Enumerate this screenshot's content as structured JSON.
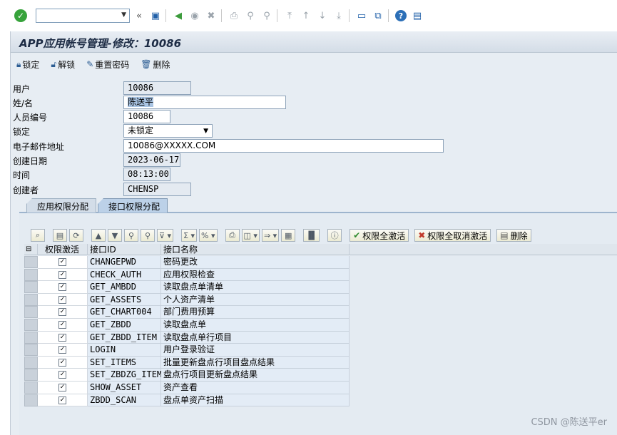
{
  "systoolbar": {
    "command_value": "",
    "icons": [
      "enter-icon",
      "save-icon",
      "back-icon",
      "exit-icon",
      "cancel-icon",
      "print-icon",
      "find-icon",
      "find-next-icon",
      "first-page-icon",
      "prev-page-icon",
      "next-page-icon",
      "last-page-icon",
      "new-session-icon",
      "shortcut-icon",
      "help-icon",
      "layout-icon"
    ]
  },
  "header": {
    "title": "APP应用帐号管理-修改：10086"
  },
  "apptoolbar": {
    "lock": "锁定",
    "unlock": "解锁",
    "reset_password": "重置密码",
    "delete": "删除"
  },
  "form": {
    "user_label": "用户",
    "user_value": "10086",
    "name_label": "姓/名",
    "name_value": "陈送平",
    "staff_label": "人员编号",
    "staff_value": "10086",
    "lock_label": "锁定",
    "lock_value": "未锁定",
    "email_label": "电子邮件地址",
    "email_value": "10086@XXXXX.COM",
    "date_label": "创建日期",
    "date_value": "2023-06-17",
    "time_label": "时间",
    "time_value": "08:13:00",
    "creator_label": "创建者",
    "creator_value": "CHENSP"
  },
  "tabs": [
    {
      "label": "应用权限分配"
    },
    {
      "label": "接口权限分配"
    }
  ],
  "alv": {
    "activate_all": "权限全激活",
    "deactivate_all": "权限全取消激活",
    "delete": "删除"
  },
  "grid": {
    "columns": {
      "active": "权限激活",
      "id": "接口ID",
      "name": "接口名称"
    },
    "rows": [
      {
        "id": "CHANGEPWD",
        "name": "密码更改",
        "checked": true
      },
      {
        "id": "CHECK_AUTH",
        "name": "应用权限检查",
        "checked": true
      },
      {
        "id": "GET_AMBDD",
        "name": "读取盘点单清单",
        "checked": true
      },
      {
        "id": "GET_ASSETS",
        "name": "个人资产清单",
        "checked": true
      },
      {
        "id": "GET_CHART004",
        "name": "部门费用预算",
        "checked": true
      },
      {
        "id": "GET_ZBDD",
        "name": "读取盘点单",
        "checked": true
      },
      {
        "id": "GET_ZBDD_ITEM",
        "name": "读取盘点单行项目",
        "checked": true
      },
      {
        "id": "LOGIN",
        "name": "用户登录验证",
        "checked": true
      },
      {
        "id": "SET_ITEMS",
        "name": "批量更新盘点行项目盘点结果",
        "checked": true
      },
      {
        "id": "SET_ZBDZG_ITEM",
        "name": "盘点行项目更新盘点结果",
        "checked": true
      },
      {
        "id": "SHOW_ASSET",
        "name": "资产查看",
        "checked": true
      },
      {
        "id": "ZBDD_SCAN",
        "name": "盘点单资产扫描",
        "checked": true
      }
    ]
  },
  "watermark": "CSDN @陈送平er"
}
